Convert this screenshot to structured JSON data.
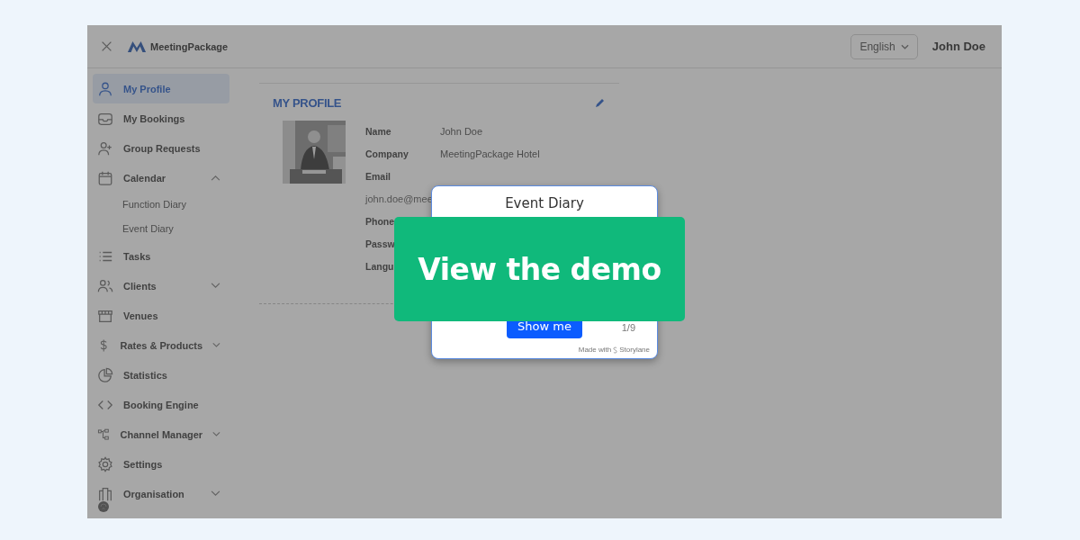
{
  "header": {
    "logo": "MeetingPackage",
    "language": "English",
    "user": "John Doe"
  },
  "sidebar": {
    "items": [
      {
        "label": "My Profile",
        "selected": true
      },
      {
        "label": "My Bookings",
        "selected": false
      },
      {
        "label": "Group Requests",
        "selected": false
      },
      {
        "label": "Calendar",
        "selected": false,
        "expanded": true,
        "children": [
          {
            "label": "Function Diary",
            "selected": false
          },
          {
            "label": "Event Diary",
            "selected": false
          }
        ]
      },
      {
        "label": "Tasks",
        "selected": false
      },
      {
        "label": "Clients",
        "selected": false,
        "expanded": false
      },
      {
        "label": "Venues",
        "selected": false
      },
      {
        "label": "Rates & Products",
        "selected": false,
        "expanded": false
      },
      {
        "label": "Statistics",
        "selected": false
      },
      {
        "label": "Booking Engine",
        "selected": false
      },
      {
        "label": "Channel Manager",
        "selected": false,
        "expanded": false
      },
      {
        "label": "Settings",
        "selected": false
      },
      {
        "label": "Organisation",
        "selected": false,
        "expanded": false
      }
    ]
  },
  "profile": {
    "title": "MY PROFILE",
    "fields": [
      {
        "label": "Name",
        "value": "John Doe"
      },
      {
        "label": "Company",
        "value": "MeetingPackage Hotel"
      },
      {
        "label": "Email"
      },
      {
        "value": "john.doe@mee"
      },
      {
        "label": "Phone"
      },
      {
        "label": "Passw"
      },
      {
        "label": "Langu"
      }
    ]
  },
  "tour_card": {
    "title": "Event Diary",
    "button": "Show me",
    "step": "1/9",
    "footer": "Made with",
    "brand": "Storylane"
  },
  "cta": {
    "label": "View the demo"
  }
}
